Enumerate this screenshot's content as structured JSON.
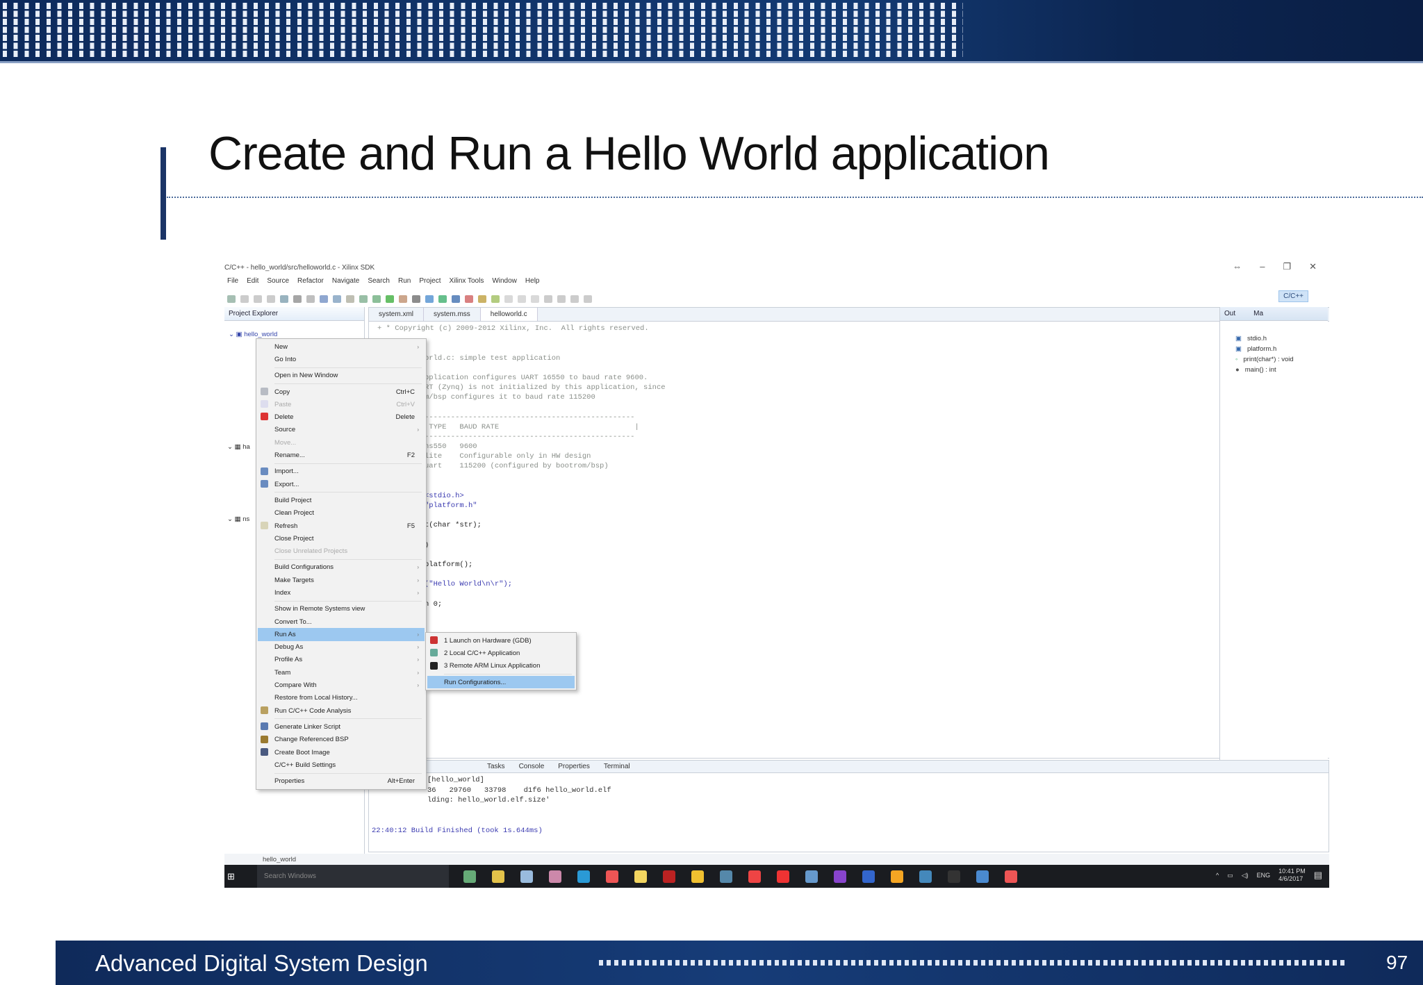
{
  "slide": {
    "title": "Create and Run a Hello World application",
    "footer": "Advanced Digital System Design",
    "page_number": "97"
  },
  "window": {
    "title": "C/C++ - hello_world/src/helloworld.c - Xilinx SDK",
    "menu": [
      "File",
      "Edit",
      "Source",
      "Refactor",
      "Navigate",
      "Search",
      "Run",
      "Project",
      "Xilinx Tools",
      "Window",
      "Help"
    ],
    "perspective": "C/C++"
  },
  "explorer": {
    "tab": "Project Explorer",
    "project": "hello_world",
    "other_projects": [
      "ha",
      "ns"
    ]
  },
  "editor": {
    "tabs": [
      "system.xml",
      "system.mss",
      "helloworld.c"
    ],
    "lines": [
      "+ * Copyright (c) 2009-2012 Xilinx, Inc.  All rights reserved.",
      "",
      "",
      "orld.c: simple test application",
      "",
      "pplication configures UART 16550 to baud rate 9600.",
      "RT (Zynq) is not initialized by this application, since",
      "m/bsp configures it to baud rate 115200",
      "",
      "------------------------------------------------",
      " TYPE   BAUD RATE                               |",
      "------------------------------------------------",
      "ns550   9600",
      "lite    Configurable only in HW design",
      "uart    115200 (configured by bootrom/bsp)",
      "",
      "",
      "<stdio.h>",
      "\"platform.h\"",
      "",
      "t(char *str);",
      "",
      ")",
      "",
      "platform();",
      "",
      "(\"Hello World\\n\\r\");",
      "",
      "n 0;"
    ]
  },
  "outline": {
    "tabs": [
      "Out",
      "Ma"
    ],
    "items": [
      "stdio.h",
      "platform.h",
      "print(char*) : void",
      "main() : int"
    ]
  },
  "console": {
    "tabs": [
      "Tasks",
      "Console",
      "Properties",
      "Terminal"
    ],
    "lines": [
      "[hello_world]",
      "36   29760   33798    d1f6 hello_world.elf",
      "lding: hello_world.elf.size'",
      "",
      "",
      "22:40:12 Build Finished (took 1s.644ms)"
    ]
  },
  "status": {
    "selection": "hello_world"
  },
  "context_menu": [
    {
      "label": "New",
      "arrow": true,
      "icon": ""
    },
    {
      "label": "Go Into",
      "icon": ""
    },
    {
      "sep": true
    },
    {
      "label": "Open in New Window",
      "icon": ""
    },
    {
      "sep": true
    },
    {
      "label": "Copy",
      "shortcut": "Ctrl+C",
      "icon": "copy-icon",
      "color": "#b8bcc4"
    },
    {
      "label": "Paste",
      "shortcut": "Ctrl+V",
      "disabled": true,
      "icon": "paste-icon",
      "color": "#dde"
    },
    {
      "label": "Delete",
      "shortcut": "Delete",
      "icon": "delete-icon",
      "color": "#d33"
    },
    {
      "label": "Source",
      "arrow": true
    },
    {
      "label": "Move...",
      "disabled": true
    },
    {
      "label": "Rename...",
      "shortcut": "F2"
    },
    {
      "sep": true
    },
    {
      "label": "Import...",
      "icon": "import-icon",
      "color": "#6a8cc0"
    },
    {
      "label": "Export...",
      "icon": "export-icon",
      "color": "#6a8cc0"
    },
    {
      "sep": true
    },
    {
      "label": "Build Project"
    },
    {
      "label": "Clean Project"
    },
    {
      "label": "Refresh",
      "shortcut": "F5",
      "icon": "refresh-icon",
      "color": "#d8d4b8"
    },
    {
      "label": "Close Project"
    },
    {
      "label": "Close Unrelated Projects",
      "disabled": true
    },
    {
      "sep": true
    },
    {
      "label": "Build Configurations",
      "arrow": true
    },
    {
      "label": "Make Targets",
      "arrow": true
    },
    {
      "label": "Index",
      "arrow": true
    },
    {
      "sep": true
    },
    {
      "label": "Show in Remote Systems view"
    },
    {
      "label": "Convert To..."
    },
    {
      "label": "Run As",
      "arrow": true,
      "highlighted": true
    },
    {
      "label": "Debug As",
      "arrow": true
    },
    {
      "label": "Profile As",
      "arrow": true
    },
    {
      "label": "Team",
      "arrow": true
    },
    {
      "label": "Compare With",
      "arrow": true
    },
    {
      "label": "Restore from Local History..."
    },
    {
      "label": "Run C/C++ Code Analysis",
      "icon": "analysis-icon",
      "color": "#b9a060"
    },
    {
      "sep": true
    },
    {
      "label": "Generate Linker Script",
      "icon": "linker-script-icon",
      "color": "#5a7ab0"
    },
    {
      "label": "Change Referenced BSP",
      "icon": "bsp-icon",
      "color": "#9a7a30"
    },
    {
      "label": "Create Boot Image",
      "icon": "boot-image-icon",
      "color": "#4a5a80"
    },
    {
      "label": "C/C++ Build Settings"
    },
    {
      "sep": true
    },
    {
      "label": "Properties",
      "shortcut": "Alt+Enter"
    }
  ],
  "run_as_submenu": [
    {
      "label": "1 Launch on Hardware (GDB)",
      "icon": "gdb-launch-icon",
      "color": "#c33"
    },
    {
      "label": "2 Local C/C++ Application",
      "icon": "c-app-icon",
      "color": "#6a9"
    },
    {
      "label": "3 Remote ARM Linux Application",
      "icon": "sigma-icon",
      "color": "#222"
    },
    {
      "sep": true
    },
    {
      "label": "Run Configurations...",
      "highlighted": true
    }
  ],
  "taskbar": {
    "search_placeholder": "Search Windows",
    "language": "ENG",
    "time": "10:41 PM",
    "date": "4/6/2017",
    "app_colors": [
      "#6a7",
      "#e3c24a",
      "#9bd",
      "#c8a",
      "#2a9ad6",
      "#e55",
      "#f2d560",
      "#b22",
      "#f0c030",
      "#58a",
      "#e44",
      "#e33",
      "#69c",
      "#84c",
      "#36c",
      "#f5a623",
      "#48b",
      "#333",
      "#4a8ad0",
      "#e55"
    ]
  }
}
